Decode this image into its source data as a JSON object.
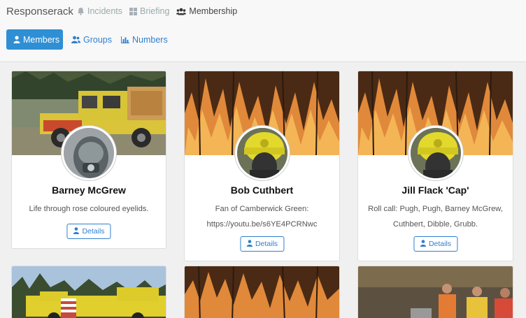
{
  "app": {
    "brand": "Responserack"
  },
  "topnav": [
    {
      "label": "Incidents",
      "icon": "bell-icon"
    },
    {
      "label": "Briefing",
      "icon": "grid-icon"
    },
    {
      "label": "Membership",
      "icon": "users-icon",
      "active": true
    }
  ],
  "tabs": [
    {
      "label": "Members",
      "icon": "user-icon",
      "active": true
    },
    {
      "label": "Groups",
      "icon": "users-icon"
    },
    {
      "label": "Numbers",
      "icon": "bar-chart-icon"
    }
  ],
  "members": [
    {
      "name": "Barney McGrew",
      "desc": "Life through rose coloured eyelids.",
      "details": "Details",
      "cover": "fire-truck"
    },
    {
      "name": "Bob Cuthbert",
      "desc": "Fan of Camberwick Green: https://youtu.be/s6YE4PCRNwc",
      "details": "Details",
      "cover": "flames"
    },
    {
      "name": "Jill Flack 'Cap'",
      "desc": "Roll call: Pugh, Pugh, Barney McGrew, Cuthbert, Dibble, Grubb.",
      "details": "Details",
      "cover": "flames"
    }
  ],
  "colors": {
    "accent": "#2f8fd4",
    "link": "#2f7fd0"
  }
}
